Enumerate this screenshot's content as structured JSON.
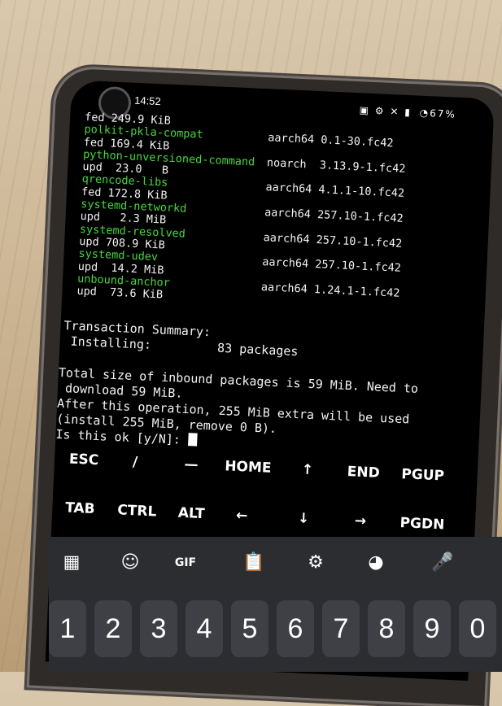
{
  "status_bar": {
    "time": "14:52",
    "battery": "67%"
  },
  "terminal": {
    "first_line": "fed 249.9 KiB",
    "packages": [
      {
        "name": "polkit-pkla-compat",
        "arch_version": "aarch64 0.1-30.fc42",
        "size": "fed 169.4 KiB"
      },
      {
        "name": "python-unversioned-command",
        "arch_version": "noarch  3.13.9-1.fc42",
        "size": "upd  23.0   B"
      },
      {
        "name": "qrencode-libs",
        "arch_version": "aarch64 4.1.1-10.fc42",
        "size": "fed 172.8 KiB"
      },
      {
        "name": "systemd-networkd",
        "arch_version": "aarch64 257.10-1.fc42",
        "size": "upd   2.3 MiB"
      },
      {
        "name": "systemd-resolved",
        "arch_version": "aarch64 257.10-1.fc42",
        "size": "upd 708.9 KiB"
      },
      {
        "name": "systemd-udev",
        "arch_version": "aarch64 257.10-1.fc42",
        "size": "upd  14.2 MiB"
      },
      {
        "name": "unbound-anchor",
        "arch_version": "aarch64 1.24.1-1.fc42",
        "size": "upd  73.6 KiB"
      }
    ],
    "summary_title": "Transaction Summary:",
    "summary_installing": " Installing:         83 packages",
    "total_line": "Total size of inbound packages is 59 MiB. Need to\n download 59 MiB.\nAfter this operation, 255 MiB extra will be used\n(install 255 MiB, remove 0 B).",
    "prompt": "Is this ok [y/N]: "
  },
  "extra_keys": {
    "row1": [
      "ESC",
      "/",
      "—",
      "HOME",
      "↑",
      "END",
      "PGUP"
    ],
    "row2": [
      "TAB",
      "CTRL",
      "ALT",
      "←",
      "↓",
      "→",
      "PGDN"
    ]
  },
  "keyboard": {
    "toolbar_icons": [
      "apps-grid-icon",
      "sticker-icon",
      "gif-icon",
      "clipboard-icon",
      "settings-gear-icon",
      "palette-icon",
      "microphone-icon"
    ],
    "gif_label": "GIF",
    "number_keys": [
      "1",
      "2",
      "3",
      "4",
      "5",
      "6",
      "7",
      "8",
      "9",
      "0"
    ]
  }
}
